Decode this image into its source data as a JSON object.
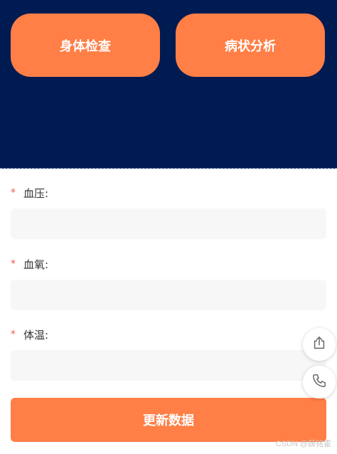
{
  "header": {
    "tiles": [
      {
        "label": "身体检查"
      },
      {
        "label": "病状分析"
      }
    ]
  },
  "form": {
    "required_mark": "*",
    "fields": [
      {
        "label": "血压:",
        "value": "",
        "placeholder": ""
      },
      {
        "label": "血氧:",
        "value": "",
        "placeholder": ""
      },
      {
        "label": "体温:",
        "value": "",
        "placeholder": ""
      }
    ]
  },
  "submit": {
    "label": "更新数据"
  },
  "floating": {
    "share_icon": "share-icon",
    "phone_icon": "phone-icon"
  },
  "watermark": {
    "text": "CSDN @薛铭霍"
  },
  "colors": {
    "header_bg": "#001a52",
    "accent": "#ff7f47",
    "required": "#f05a4a",
    "input_bg": "#f7f7f7"
  }
}
